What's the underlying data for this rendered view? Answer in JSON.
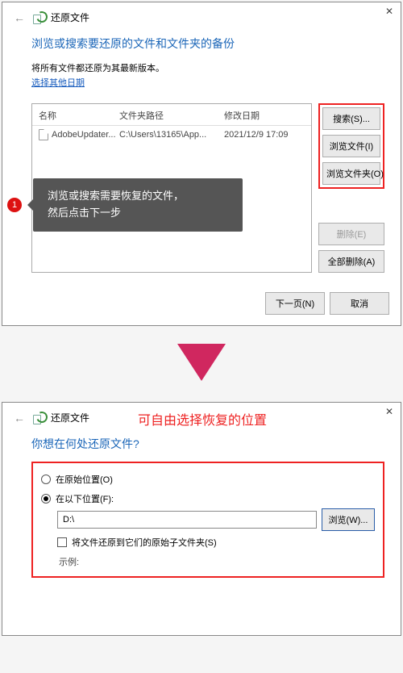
{
  "top": {
    "title": "还原文件",
    "heading": "浏览或搜索要还原的文件和文件夹的备份",
    "subline": "将所有文件都还原为其最新版本。",
    "link_other_date": "选择其他日期",
    "columns": {
      "name": "名称",
      "path": "文件夹路径",
      "date": "修改日期"
    },
    "row": {
      "name": "AdobeUpdater...",
      "path": "C:\\Users\\13165\\App...",
      "date": "2021/12/9 17:09"
    },
    "side": {
      "search": "搜索(S)...",
      "browse_file": "浏览文件(I)",
      "browse_folder": "浏览文件夹(O)",
      "delete": "删除(E)",
      "delete_all": "全部删除(A)"
    },
    "footer": {
      "next": "下一页(N)",
      "cancel": "取消"
    },
    "tooltip": {
      "badge": "1",
      "line1": "浏览或搜索需要恢复的文件，",
      "line2": "然后点击下一步"
    }
  },
  "bottom": {
    "title": "还原文件",
    "annot": "可自由选择恢复的位置",
    "heading": "你想在何处还原文件?",
    "opt_orig": "在原始位置(O)",
    "opt_custom": "在以下位置(F):",
    "path_value": "D:\\",
    "browse": "浏览(W)...",
    "chk_sub": "将文件还原到它们的原始子文件夹(S)",
    "example": "示例:"
  }
}
